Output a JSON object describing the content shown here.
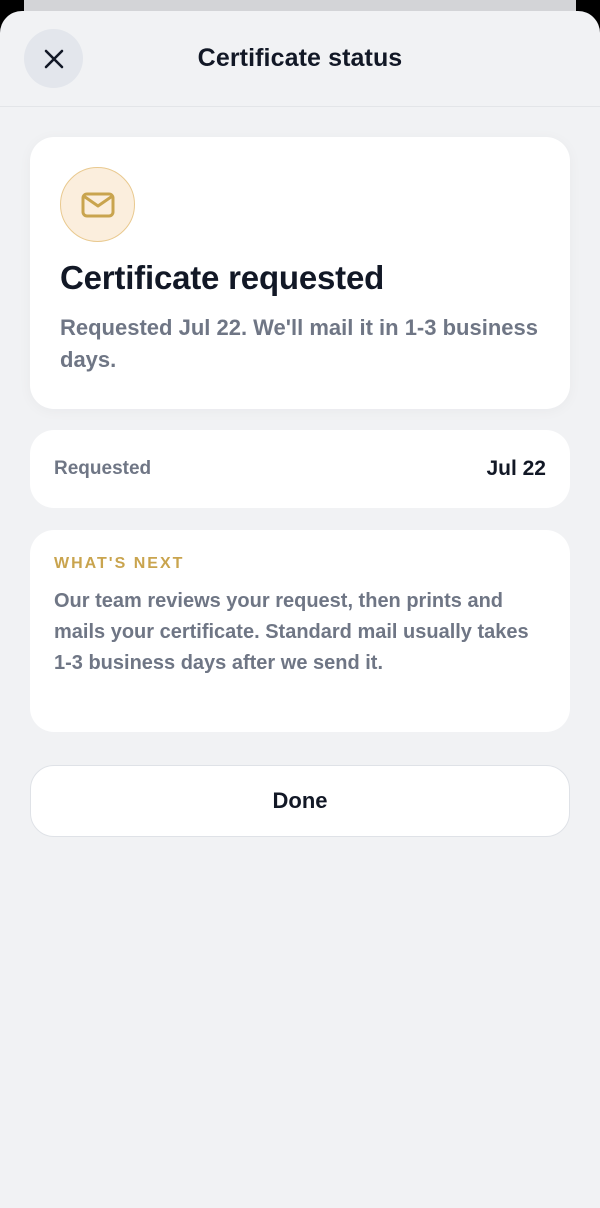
{
  "header": {
    "title": "Certificate status",
    "close_icon": "close-icon"
  },
  "status_card": {
    "icon": "mail-icon",
    "title": "Certificate requested",
    "description": "Requested Jul 22. We'll mail it in 1-3 business days."
  },
  "details": {
    "label": "Requested",
    "value": "Jul 22"
  },
  "whats_next": {
    "heading": "WHAT'S NEXT",
    "body": "Our team reviews your request, then prints and mails your certificate. Standard mail usually takes 1-3 business days after we send it."
  },
  "actions": {
    "done_label": "Done"
  },
  "colors": {
    "accent": "#c9a44e",
    "icon_bg": "#fbeedd",
    "text_primary": "#121826",
    "text_secondary": "#6f7685",
    "background": "#f1f2f4"
  }
}
